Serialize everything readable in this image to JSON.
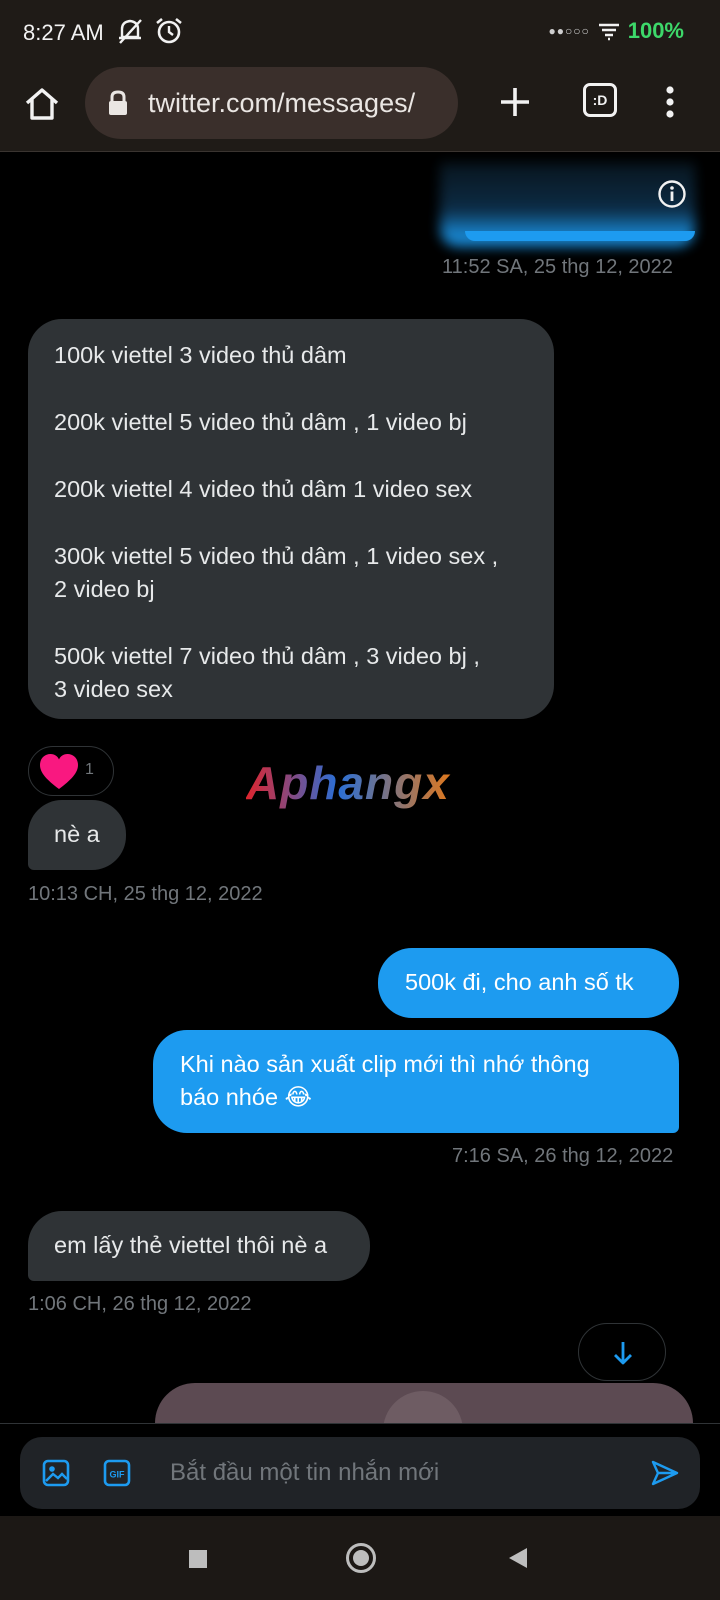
{
  "status_bar": {
    "time": "8:27 AM",
    "battery": "100%",
    "icons": [
      "mute-icon",
      "alarm-icon",
      "signal-icon",
      "wifi-icon"
    ]
  },
  "browser": {
    "url": "twitter.com/messages/",
    "tabs_label": ":D",
    "icons": [
      "home-icon",
      "lock-icon",
      "plus-icon",
      "tabs-icon",
      "menu-icon"
    ]
  },
  "conversation": {
    "timestamp_1": "11:52 SA, 25 thg 12, 2022",
    "price_list": [
      "100k viettel 3 video thủ dâm",
      "200k viettel 5 video thủ dâm , 1 video bj",
      "200k viettel 4 video thủ dâm 1 video sex",
      "300k viettel 5 video thủ dâm , 1 video sex ,",
      "2 video bj",
      "500k viettel 7 video thủ dâm , 3 video bj ,",
      "3 video sex"
    ],
    "reaction_count": "1",
    "watermark": "Aphangx",
    "msg_ne_a": "nè a",
    "timestamp_2": "10:13 CH, 25 thg 12, 2022",
    "out_msg_1": "500k đi, cho anh số tk",
    "out_msg_2_line1": "Khi nào sản xuất clip mới thì nhớ thông",
    "out_msg_2_line2": "báo nhóe 😂",
    "timestamp_3": "7:16 SA, 26 thg 12, 2022",
    "in_msg_3": "em lấy thẻ viettel thôi nè a",
    "timestamp_4": "1:06 CH, 26 thg 12, 2022"
  },
  "composer": {
    "placeholder": "Bắt đầu một tin nhắn mới"
  },
  "colors": {
    "accent": "#1d9bf0",
    "incoming_bubble": "#2f3336",
    "timestamp": "#71767b",
    "battery": "#3dd86a"
  }
}
